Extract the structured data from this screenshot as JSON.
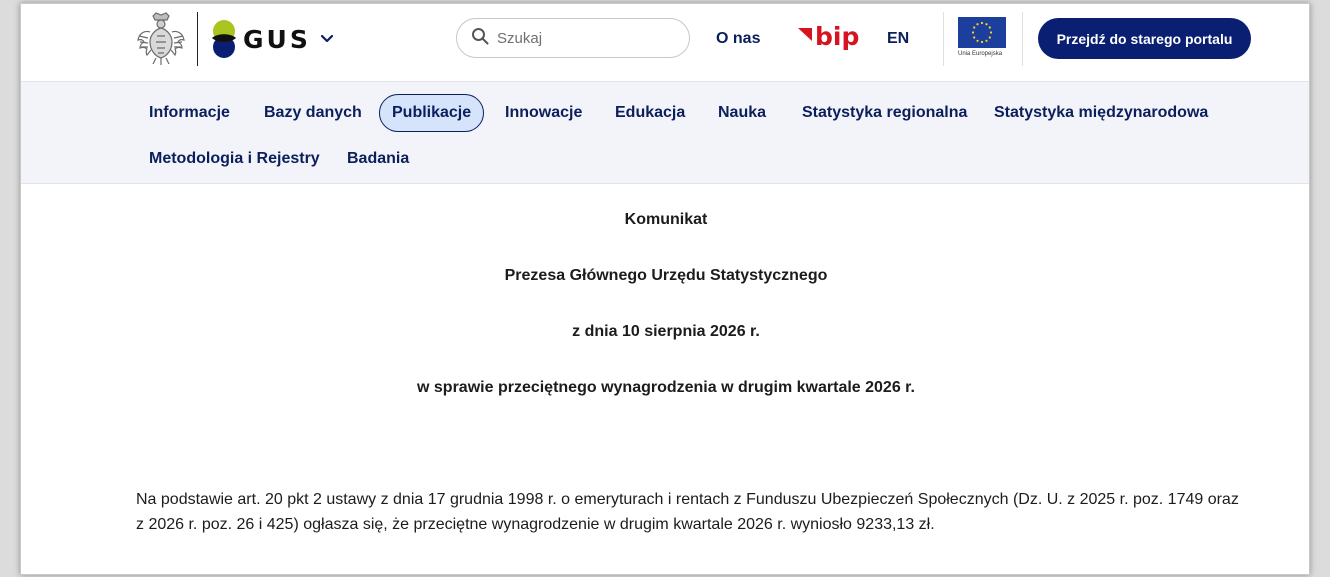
{
  "header": {
    "logo_text": "GUS",
    "search_placeholder": "Szukaj",
    "about_label": "O nas",
    "bip_label": "bip",
    "language_label": "EN",
    "eu_label": "Unia Europejska",
    "old_portal_label": "Przejdź do starego portalu"
  },
  "nav": {
    "items": [
      {
        "label": "Informacje"
      },
      {
        "label": "Bazy danych"
      },
      {
        "label": "Publikacje",
        "active": true
      },
      {
        "label": "Innowacje"
      },
      {
        "label": "Edukacja"
      },
      {
        "label": "Nauka"
      },
      {
        "label": "Statystyka regionalna"
      },
      {
        "label": "Statystyka międzynarodowa"
      },
      {
        "label": "Metodologia i Rejestry"
      },
      {
        "label": "Badania"
      }
    ]
  },
  "announcement": {
    "line1": "Komunikat",
    "line2": "Prezesa Głównego Urzędu Statystycznego",
    "line3": "z dnia 10 sierpnia 2026 r.",
    "line4": "w sprawie przeciętnego wynagrodzenia w drugim kwartale 2026 r.",
    "body": "Na podstawie art. 20 pkt 2 ustawy z dnia 17 grudnia 1998 r. o emeryturach i rentach z Funduszu Ubezpieczeń Społecznych (Dz. U. z 2025 r. poz. 1749 oraz z 2026 r. poz. 26 i 425) ogłasza się, że przeciętne wynagrodzenie w drugim kwartale 2026 r. wyniosło 9233,13 zł."
  },
  "colors": {
    "brand_navy": "#0a1f72",
    "nav_text": "#0a1f5c",
    "nav_background": "#f3f4f9",
    "active_tab_background": "#d6e4fb",
    "bip_red": "#d5141f",
    "gus_green": "#a8c520"
  },
  "icons": {
    "eagle": "polish-eagle-emblem",
    "gus_mark": "gus-logo-mark",
    "search": "search-icon",
    "chevron": "chevron-down-icon",
    "bip": "bip-flag-icon",
    "eu": "eu-flag-icon"
  }
}
